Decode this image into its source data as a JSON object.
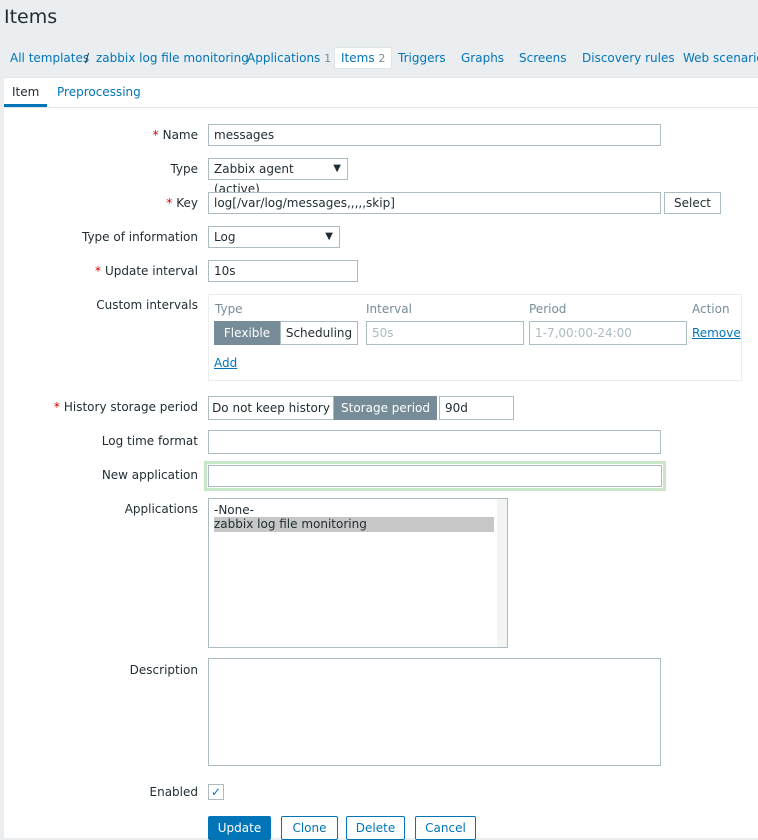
{
  "page": {
    "title": "Items"
  },
  "breadcrumbs": {
    "all_templates": "All templates",
    "separator": "/",
    "template": "zabbix log file monitoring",
    "applications": "Applications",
    "applications_count": "1",
    "items": "Items",
    "items_count": "2",
    "triggers": "Triggers",
    "graphs": "Graphs",
    "screens": "Screens",
    "discovery_rules": "Discovery rules",
    "web_scenarios": "Web scenarios"
  },
  "tabs": {
    "item": "Item",
    "preprocessing": "Preprocessing"
  },
  "form": {
    "required_mark": "*",
    "name": {
      "label": "Name",
      "value": "messages"
    },
    "type": {
      "label": "Type",
      "value": "Zabbix agent (active)"
    },
    "key": {
      "label": "Key",
      "value": "log[/var/log/messages,,,,,skip]",
      "select_button": "Select"
    },
    "type_of_information": {
      "label": "Type of information",
      "value": "Log"
    },
    "update_interval": {
      "label": "Update interval",
      "value": "10s"
    },
    "custom_intervals": {
      "label": "Custom intervals",
      "headers": {
        "type": "Type",
        "interval": "Interval",
        "period": "Period",
        "action": "Action"
      },
      "flexible": "Flexible",
      "scheduling": "Scheduling",
      "interval_placeholder": "50s",
      "period_placeholder": "1-7,00:00-24:00",
      "remove": "Remove",
      "add": "Add"
    },
    "history": {
      "label": "History storage period",
      "no_keep": "Do not keep history",
      "storage_period": "Storage period",
      "value": "90d"
    },
    "log_time_format": {
      "label": "Log time format",
      "value": ""
    },
    "new_application": {
      "label": "New application",
      "value": ""
    },
    "applications": {
      "label": "Applications",
      "options": [
        "-None-",
        "zabbix log file monitoring"
      ]
    },
    "description": {
      "label": "Description",
      "value": ""
    },
    "enabled": {
      "label": "Enabled",
      "check": "✓"
    }
  },
  "buttons": {
    "update": "Update",
    "clone": "Clone",
    "delete": "Delete",
    "cancel": "Cancel"
  },
  "colors": {
    "accent": "#0275b8",
    "required": "#d40000",
    "segment_active": "#768d99",
    "focus": "#c8e6c9"
  }
}
